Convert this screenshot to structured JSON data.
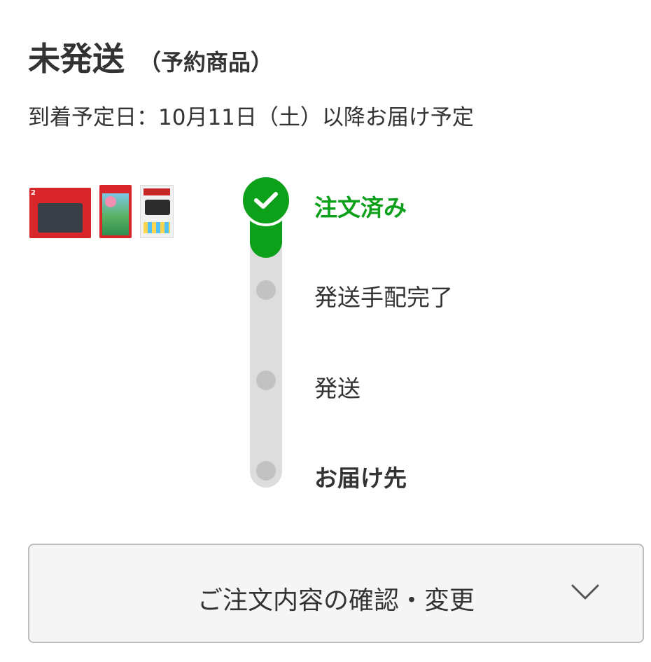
{
  "header": {
    "status_title": "未発送",
    "status_note": "（予約商品）",
    "arrival_text": "到着予定日：10月11日（土）以降お届け予定"
  },
  "products": [
    {
      "icon": "console-box-thumbnail",
      "badge": "2"
    },
    {
      "icon": "game-cartridge-thumbnail"
    },
    {
      "icon": "accessory-package-thumbnail"
    }
  ],
  "progress": {
    "current_step": 1,
    "total_steps": 4,
    "steps": [
      {
        "label": "注文済み",
        "state": "done"
      },
      {
        "label": "発送手配完了",
        "state": "pending"
      },
      {
        "label": "発送",
        "state": "pending"
      },
      {
        "label": "お届け先",
        "state": "pending"
      }
    ]
  },
  "actions": {
    "confirm_change_label": "ご注文内容の確認・変更",
    "expand_icon": "chevron-down-icon"
  },
  "colors": {
    "accent_green": "#0da01a",
    "track_gray": "#dddddd",
    "dot_gray": "#c2c2c2",
    "text": "#333333",
    "button_bg": "#f5f5f5",
    "button_border": "#bdbdbd"
  }
}
